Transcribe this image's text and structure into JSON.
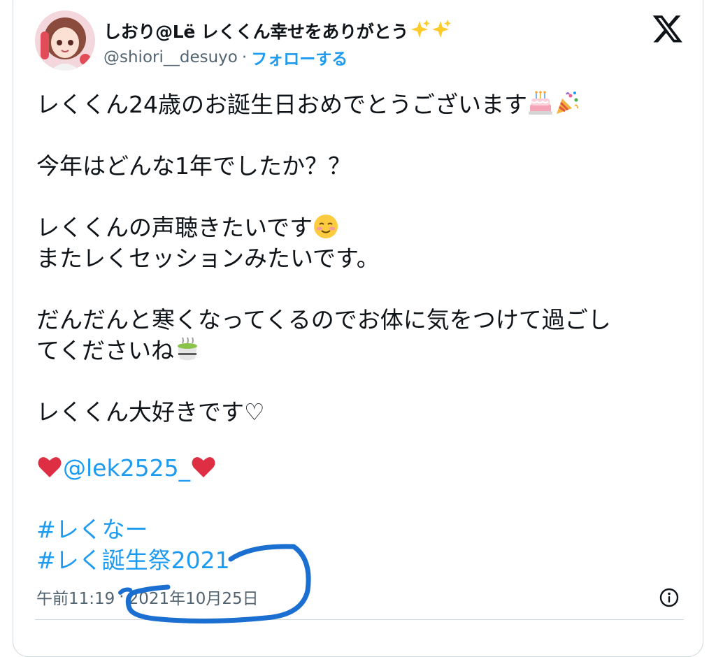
{
  "author": {
    "display_name": "しおり@Lë レくくん幸せをありがとう",
    "handle": "@shiori__desuyo",
    "separator": "·",
    "follow_label": "フォローする"
  },
  "tweet": {
    "lines": {
      "l1": "レくくん24歳のお誕生日おめでとうございます",
      "l2": "今年はどんな1年でしたか？？",
      "l3": "レくくんの声聴きたいです",
      "l4": "またレくセッションみたいです。",
      "l5": "だんだんと寒くなってくるのでお体に気をつけて過ごし",
      "l6": "てくださいね",
      "l7": "レくくん大好きです♡",
      "mention": "@lek2525_",
      "hashtag1": "#レくなー",
      "hashtag2": "#レく誕生祭2021"
    }
  },
  "meta": {
    "time": "午前11:19",
    "separator": "·",
    "date": "2021年10月25日"
  },
  "colors": {
    "link": "#1d9bf0",
    "text": "#0f1419",
    "secondary": "#536471",
    "annotation_stroke": "#1a6fd1"
  },
  "icons": [
    "x-logo-icon",
    "info-icon",
    "sparkles-icon",
    "birthday-cake-icon",
    "party-popper-icon",
    "smiling-face-icon",
    "green-tea-icon",
    "red-heart-icon"
  ]
}
